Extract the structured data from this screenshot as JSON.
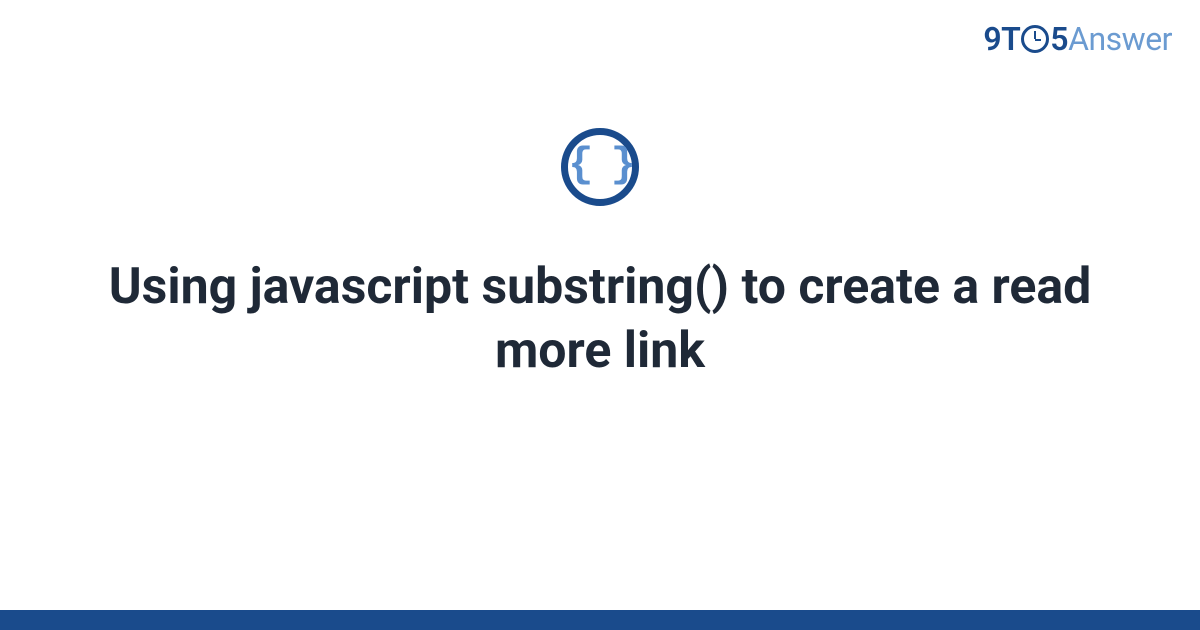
{
  "logo": {
    "part1": "9T",
    "part2": "5",
    "part3": "Answer"
  },
  "icon": {
    "name": "code-braces-icon",
    "glyph": "{ }"
  },
  "title": "Using javascript substring() to create a read more link",
  "colors": {
    "brand_dark": "#1a4b8c",
    "brand_light": "#6b9bd1",
    "text": "#1f2937"
  }
}
